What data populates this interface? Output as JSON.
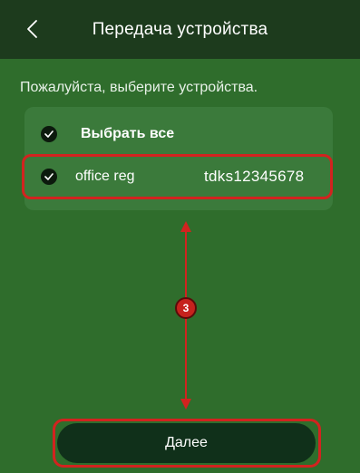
{
  "header": {
    "back_icon": "chevron-left-icon",
    "title": "Передача устройства"
  },
  "instruction": "Пожалуйста, выберите устройства.",
  "list": {
    "select_all": {
      "label": "Выбрать все",
      "checked": true
    },
    "devices": [
      {
        "name": "office reg",
        "serial": "tdks12345678",
        "checked": true
      }
    ]
  },
  "annotation": {
    "step_number": "3",
    "color": "#d2231f"
  },
  "footer": {
    "next_label": "Далее"
  },
  "colors": {
    "background": "#2f6d2c",
    "top_bar": "#1d3b1d",
    "card": "#3b7a3b",
    "button": "#10301a",
    "highlight": "#d2231f"
  }
}
